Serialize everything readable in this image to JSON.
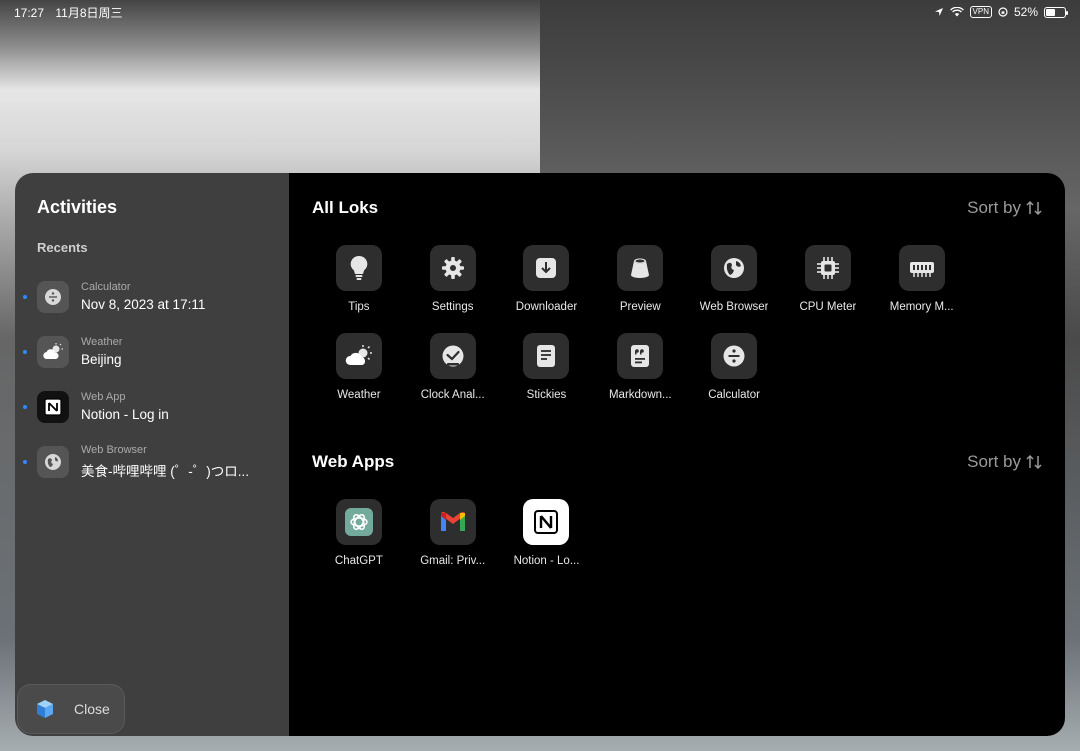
{
  "status": {
    "time": "17:27",
    "date": "11月8日周三",
    "vpn": "VPN",
    "battery": "52%",
    "battery_level": 0.52
  },
  "sidebar": {
    "title": "Activities",
    "recents_label": "Recents",
    "recents": [
      {
        "app": "Calculator",
        "detail": "Nov 8, 2023 at 17:11",
        "icon": "divide-icon"
      },
      {
        "app": "Weather",
        "detail": "Beijing",
        "icon": "cloud-sun-icon"
      },
      {
        "app": "Web App",
        "detail": "Notion - Log in",
        "icon": "notion-icon"
      },
      {
        "app": "Web Browser",
        "detail": "美食-哔哩哔哩 (゜-゜)つロ...",
        "icon": "globe-icon"
      }
    ],
    "close_label": "Close"
  },
  "all_loks": {
    "title": "All Loks",
    "sort_label": "Sort by",
    "apps": [
      {
        "label": "Tips",
        "icon": "lightbulb-icon"
      },
      {
        "label": "Settings",
        "icon": "gear-icon"
      },
      {
        "label": "Downloader",
        "icon": "download-icon"
      },
      {
        "label": "Preview",
        "icon": "preview-icon"
      },
      {
        "label": "Web Browser",
        "icon": "globe-icon"
      },
      {
        "label": "CPU Meter",
        "icon": "cpu-icon"
      },
      {
        "label": "Memory M...",
        "icon": "memory-icon"
      },
      {
        "label": "Weather",
        "icon": "cloud-sun-icon"
      },
      {
        "label": "Clock Anal...",
        "icon": "clock-icon"
      },
      {
        "label": "Stickies",
        "icon": "note-icon"
      },
      {
        "label": "Markdown...",
        "icon": "markdown-icon"
      },
      {
        "label": "Calculator",
        "icon": "divide-icon"
      }
    ]
  },
  "web_apps": {
    "title": "Web Apps",
    "sort_label": "Sort by",
    "apps": [
      {
        "label": "ChatGPT",
        "icon": "chatgpt-icon"
      },
      {
        "label": "Gmail: Priv...",
        "icon": "gmail-icon"
      },
      {
        "label": "Notion - Lo...",
        "icon": "notion-icon"
      }
    ]
  },
  "colors": {
    "accent_dot": "#2f8bff",
    "sidebar_bg": "#3f3f3f",
    "content_bg": "#000000",
    "chatgpt_bg": "#74aa9c"
  }
}
